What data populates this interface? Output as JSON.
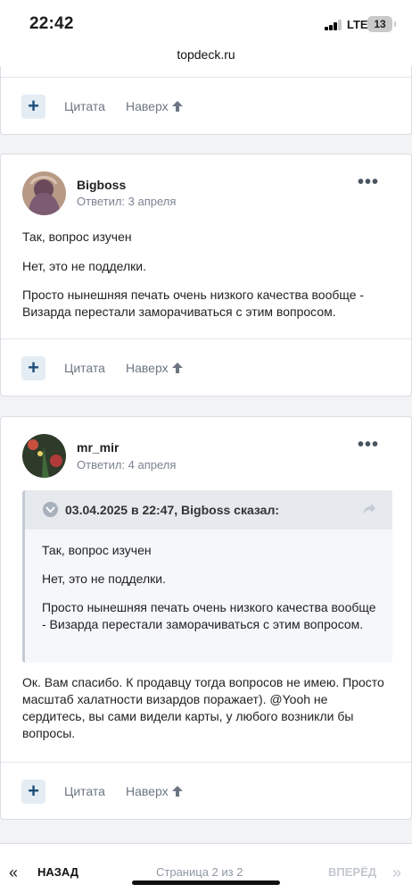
{
  "status_bar": {
    "time": "22:42",
    "network": "LTE",
    "battery": "13"
  },
  "browser": {
    "url": "topdeck.ru"
  },
  "post_actions": {
    "plus": "+",
    "quote": "Цитата",
    "to_top": "Наверх"
  },
  "posts": [
    {
      "username": "Bigboss",
      "replied": "Ответил: 3 апреля",
      "more": "•••",
      "paragraphs": [
        "Так, вопрос изучен",
        "Нет, это не подделки.",
        "Просто нынешняя печать очень низкого качества вообще - Визарда перестали заморачиваться с этим вопросом."
      ]
    },
    {
      "username": "mr_mir",
      "replied": "Ответил: 4 апреля",
      "more": "•••",
      "quote": {
        "header": "03.04.2025 в 22:47, Bigboss сказал:",
        "paragraphs": [
          "Так, вопрос изучен",
          "Нет, это не подделки.",
          "Просто нынешняя печать очень низкого качества вообще - Визарда перестали заморачиваться с этим вопросом."
        ]
      },
      "paragraphs": [
        "Ок. Вам спасибо. К продавцу тогда вопросов не имею. Просто масштаб халатности визардов поражает). @Yooh не сердитесь, вы сами видели карты, у любого возникли бы вопросы."
      ]
    }
  ],
  "pagination": {
    "prev_icon": "«",
    "prev": "НАЗАД",
    "page": "Страница 2 из 2",
    "next": "ВПЕРЁД",
    "next_icon": "»"
  }
}
